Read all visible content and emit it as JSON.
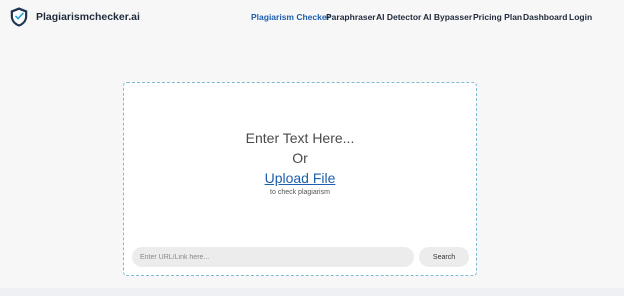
{
  "header": {
    "brand": "Plagiarismchecker.ai",
    "logo_icon": "shield-check-icon",
    "nav": [
      {
        "label": "Plagiarism Checker",
        "active": true
      },
      {
        "label": "Paraphraser",
        "active": false
      },
      {
        "label": "AI Detector",
        "active": false
      },
      {
        "label": "AI Bypasser",
        "active": false
      },
      {
        "label": "Pricing Plan",
        "active": false
      },
      {
        "label": "Dashboard",
        "active": false
      },
      {
        "label": "Login",
        "active": false
      }
    ]
  },
  "main": {
    "enter_text": "Enter Text Here...",
    "or_text": "Or",
    "upload_label": "Upload File",
    "to_check": "to check plagiarism",
    "url_input": {
      "placeholder": "Enter URL/Link here...",
      "value": ""
    },
    "search_label": "Search"
  },
  "colors": {
    "accent": "#1d5fae",
    "logo_dark": "#1f3550",
    "card_border": "#7fb9d2"
  }
}
